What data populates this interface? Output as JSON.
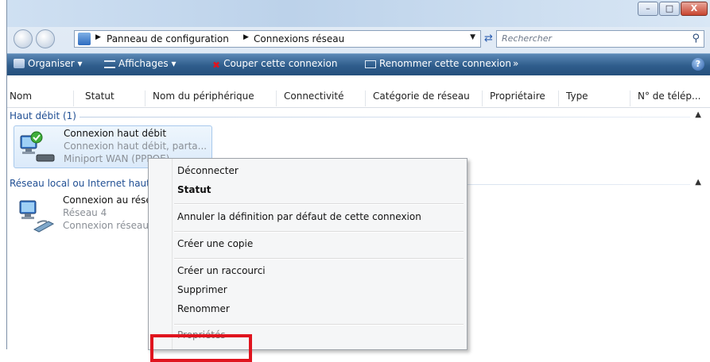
{
  "window": {
    "title": "Connexions réseau",
    "controls": [
      "minimize",
      "maximize",
      "close"
    ],
    "close_glyph": "X"
  },
  "address": {
    "crumbs": [
      "Panneau de configuration",
      "Connexions réseau"
    ],
    "search_placeholder": "Rechercher"
  },
  "toolbar": {
    "organize": "Organiser",
    "views": "Affichages",
    "disconnect": "Couper cette connexion",
    "rename": "Renommer cette connexion",
    "more": "»",
    "help": "?"
  },
  "columns": [
    "Nom",
    "Statut",
    "Nom du périphérique",
    "Connectivité",
    "Catégorie de réseau",
    "Propriétaire",
    "Type",
    "N° de télép..."
  ],
  "groups": [
    {
      "title": "Haut débit (1)",
      "items": [
        {
          "name": "Connexion haut débit",
          "line2": "Connexion haut débit, parta...",
          "line3": "Miniport WAN (PPPOE)",
          "connected": true,
          "selected": true
        }
      ]
    },
    {
      "title": "Réseau local ou Internet haut débit",
      "items": [
        {
          "name": "Connexion au réseau local",
          "line2": "Réseau 4",
          "line3": "Connexion réseau",
          "connected": false,
          "selected": false
        }
      ]
    }
  ],
  "context_menu": {
    "items": [
      {
        "label": "Déconnecter",
        "bold": false
      },
      {
        "label": "Statut",
        "bold": true
      },
      {
        "label": "Annuler la définition par défaut de cette connexion",
        "bold": false
      },
      {
        "label": "Créer une copie",
        "bold": false
      },
      {
        "label": "Créer un raccourci",
        "bold": false
      },
      {
        "label": "Supprimer",
        "bold": false
      },
      {
        "label": "Renommer",
        "bold": false
      },
      {
        "label": "Propriétés",
        "bold": false
      }
    ]
  },
  "colors": {
    "toolbar": "#2f5d8c",
    "group_title": "#1f4e93",
    "highlight": "#e0141e",
    "disconnect_icon": "#e0141e"
  },
  "icons": [
    "back-arrow-icon",
    "forward-arrow-icon",
    "control-panel-icon",
    "refresh-icon",
    "search-icon",
    "organize-icon",
    "views-icon",
    "disconnect-icon",
    "rename-icon",
    "help-icon",
    "network-connection-icon",
    "connected-check-icon",
    "chevron-up-icon"
  ]
}
